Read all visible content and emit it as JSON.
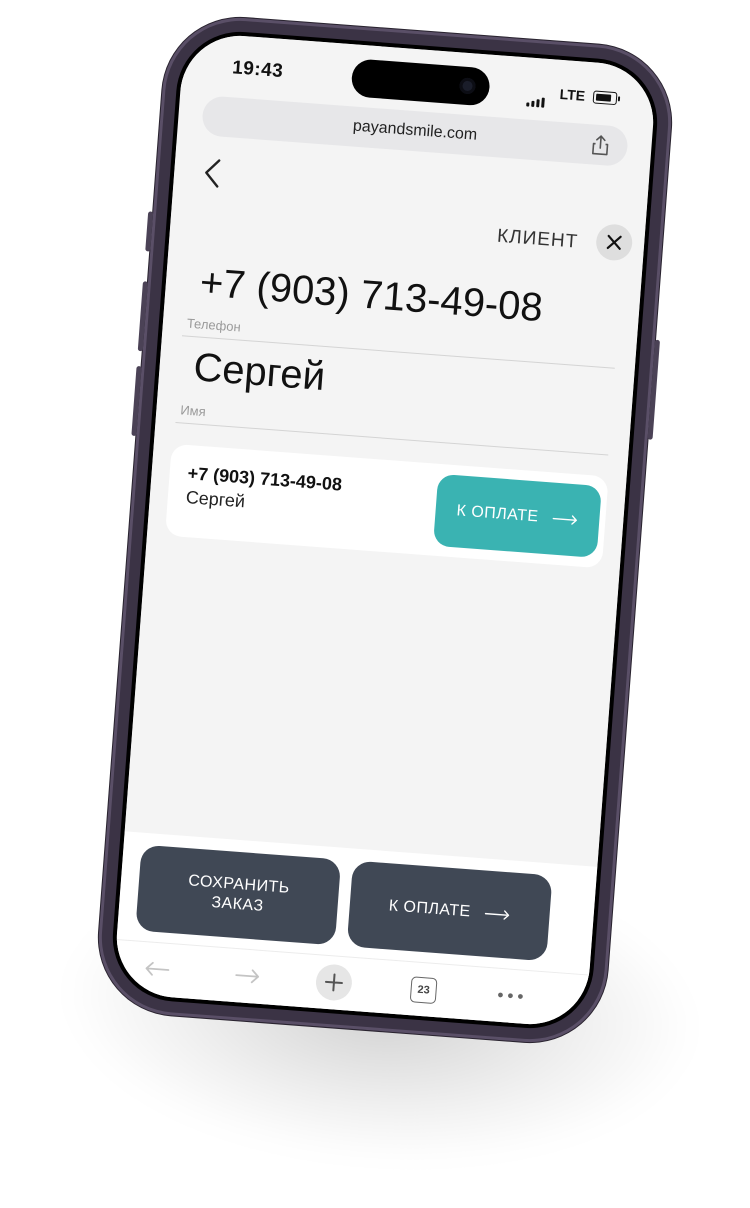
{
  "status_bar": {
    "time": "19:43",
    "network": "LTE"
  },
  "browser": {
    "url": "payandsmile.com",
    "tab_count": "23"
  },
  "header": {
    "title": "КЛИЕНТ"
  },
  "form": {
    "phone": {
      "value": "+7 (903) 713-49-08",
      "caption": "Телефон"
    },
    "name": {
      "value": "Сергей",
      "caption": "Имя"
    }
  },
  "client_card": {
    "phone": "+7 (903) 713-49-08",
    "name": "Сергей",
    "pay_label": "К ОПЛАТЕ"
  },
  "actions": {
    "save_label_line1": "СОХРАНИТЬ",
    "save_label_line2": "ЗАКАЗ",
    "pay_label": "К ОПЛАТЕ"
  },
  "colors": {
    "accent": "#3ab3b2",
    "dark_button": "#404855",
    "phone_frame": "#3b3345"
  }
}
